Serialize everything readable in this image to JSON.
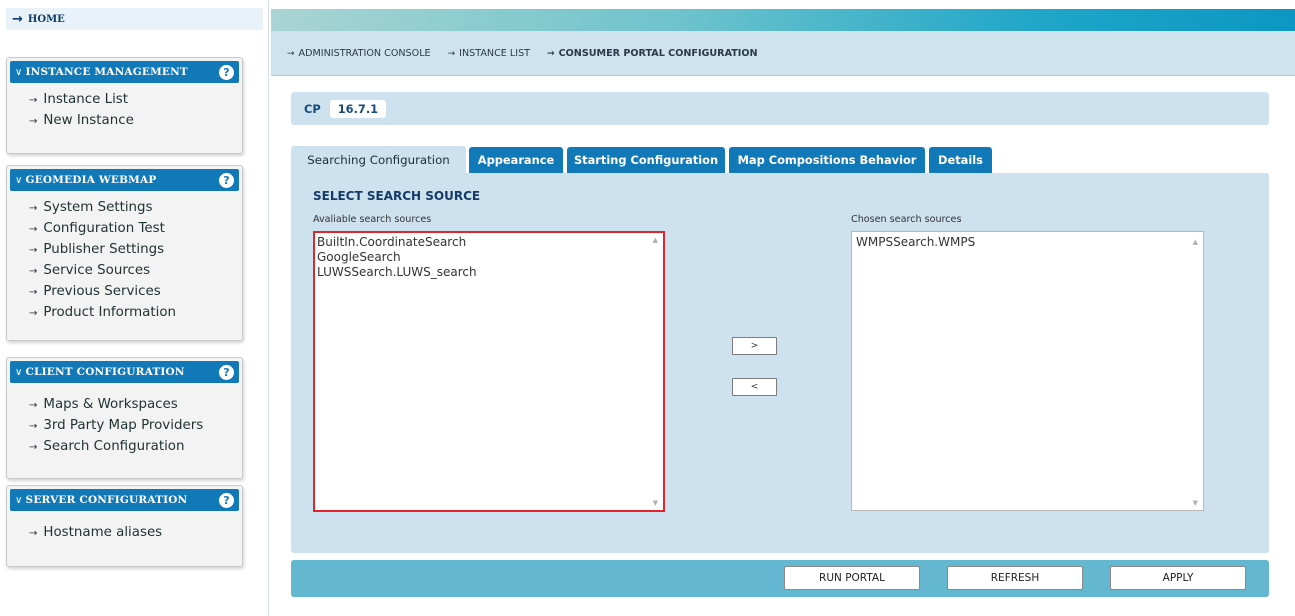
{
  "sidebar": {
    "home_arrow": "→",
    "home_label": "HOME",
    "panels": [
      {
        "title": "INSTANCE MANAGEMENT",
        "items": [
          "Instance List",
          "New Instance"
        ]
      },
      {
        "title": "GEOMEDIA WEBMAP",
        "items": [
          "System Settings",
          "Configuration Test",
          "Publisher Settings",
          "Service Sources",
          "Previous Services",
          "Product Information"
        ]
      },
      {
        "title": "CLIENT CONFIGURATION",
        "items": [
          "Maps & Workspaces",
          "3rd Party Map Providers",
          "Search Configuration"
        ]
      },
      {
        "title": "SERVER CONFIGURATION",
        "items": [
          "Hostname aliases"
        ]
      }
    ],
    "help_glyph": "?",
    "chevron_glyph": "∨",
    "bullet_glyph": "→"
  },
  "breadcrumb": {
    "arrow": "→",
    "items": [
      "ADMINISTRATION CONSOLE",
      "INSTANCE LIST",
      "CONSUMER PORTAL CONFIGURATION"
    ]
  },
  "version": {
    "label": "CP",
    "value": "16.7.1"
  },
  "tabs": [
    "Searching Configuration",
    "Appearance",
    "Starting Configuration",
    "Map Compositions Behavior",
    "Details"
  ],
  "search_config": {
    "section_title": "SELECT SEARCH SOURCE",
    "available_label": "Avaliable search sources",
    "chosen_label": "Chosen search sources",
    "available": [
      "BuiltIn.CoordinateSearch",
      "GoogleSearch",
      "LUWSSearch.LUWS_search"
    ],
    "chosen": [
      "WMPSSearch.WMPS"
    ],
    "add_button": ">",
    "remove_button": "<",
    "scroll_up_glyph": "▲",
    "scroll_down_glyph": "▼"
  },
  "actions": {
    "run": "RUN PORTAL",
    "refresh": "REFRESH",
    "apply": "APPLY"
  },
  "colors": {
    "accent": "#1279b9",
    "panel_bg": "#cde2ee",
    "action_bar": "#63b7d0",
    "highlight_border": "#e4232b"
  }
}
